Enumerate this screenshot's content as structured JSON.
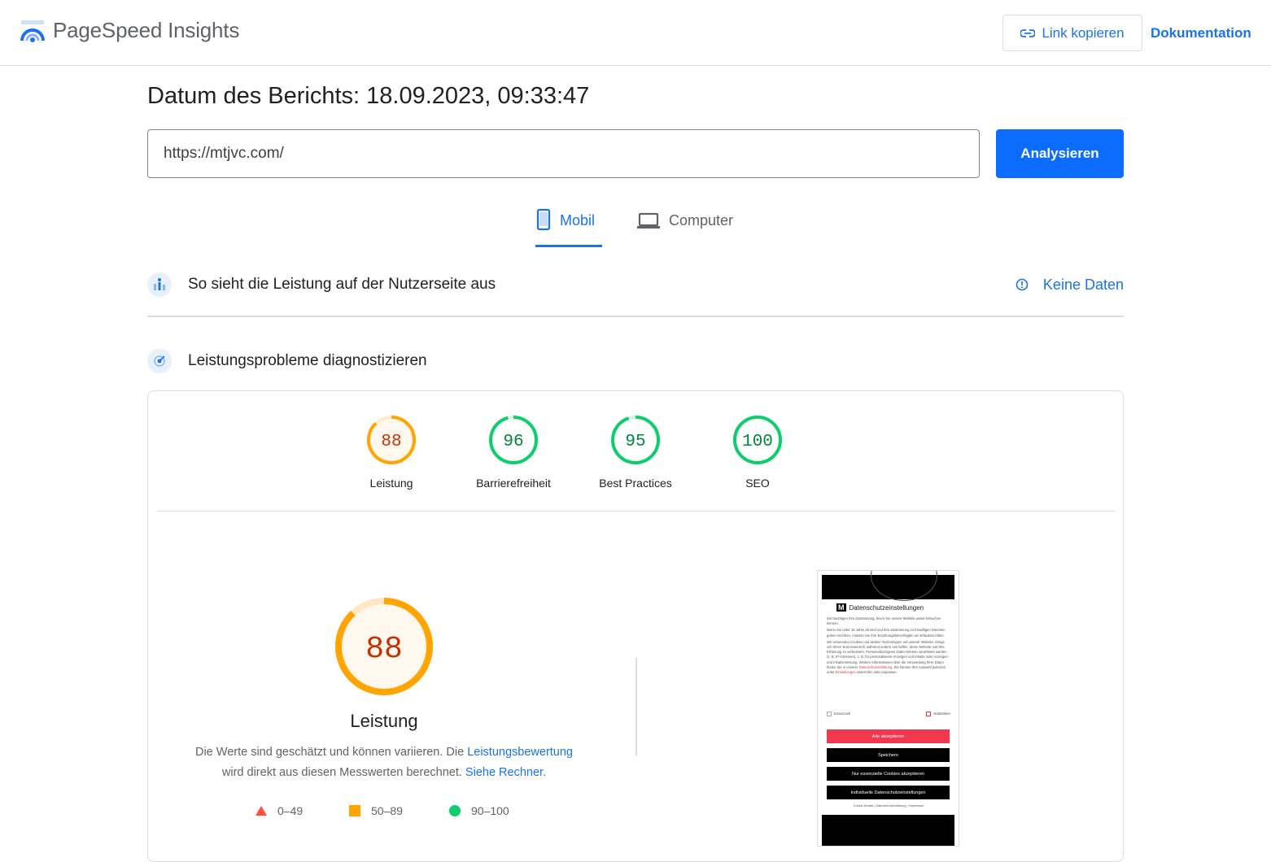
{
  "header": {
    "brand": "PageSpeed Insights",
    "copy_link_label": "Link kopieren",
    "docs_label": "Dokumentation"
  },
  "report": {
    "date_label": "Datum des Berichts: 18.09.2023, 09:33:47",
    "url_value": "https://mtjvc.com/",
    "analyze_label": "Analysieren"
  },
  "tabs": [
    {
      "label": "Mobil",
      "icon": "phone-icon",
      "active": true
    },
    {
      "label": "Computer",
      "icon": "laptop-icon",
      "active": false
    }
  ],
  "field_section": {
    "title": "So sieht die Leistung auf der Nutzerseite aus",
    "status": "Keine Daten"
  },
  "diagnose_section": {
    "title": "Leistungsprobleme diagnostizieren"
  },
  "scores": [
    {
      "label": "Leistung",
      "value": "88",
      "score": 0.88,
      "color": "#ffa400",
      "text_color": "#c33300",
      "fill": "#fff8ef"
    },
    {
      "label": "Barrierefreiheit",
      "value": "96",
      "score": 0.96,
      "color": "#0cce6b",
      "text_color": "#018642",
      "fill": "#ffffff"
    },
    {
      "label": "Best Practices",
      "value": "95",
      "score": 0.95,
      "color": "#0cce6b",
      "text_color": "#018642",
      "fill": "#ffffff"
    },
    {
      "label": "SEO",
      "value": "100",
      "score": 1.0,
      "color": "#0cce6b",
      "text_color": "#018642",
      "fill": "#ffffff"
    }
  ],
  "performance": {
    "value": "88",
    "score": 0.88,
    "title": "Leistung",
    "desc_part1": "Die Werte sind geschätzt und können variieren. Die ",
    "desc_link1": "Leistungsbewertung",
    "desc_part2": "wird direkt aus diesen Messwerten berechnet. ",
    "desc_link2": "Siehe Rechner."
  },
  "legend": [
    {
      "shape": "triangle",
      "range": "0–49",
      "color": "#ff4e42"
    },
    {
      "shape": "square",
      "range": "50–89",
      "color": "#ffa400"
    },
    {
      "shape": "circle",
      "range": "90–100",
      "color": "#0cce6b"
    }
  ],
  "thumbnail": {
    "title": "Datenschutzeinstellungen",
    "logo": "M",
    "para1": "Wir benötigen Ihre Zustimmung, bevor Sie unsere Website weiter besuchen können.",
    "para2": "Wenn Sie unter 16 Jahre alt sind und Ihre Zustimmung zu freiwilligen Diensten geben möchten, müssen Sie Ihre Erziehungsberechtigten um Erlaubnis bitten.",
    "para3": "Wir verwenden Cookies und andere Technologien auf unserer Website. Einige von ihnen sind essenziell, während andere uns helfen, diese Website und Ihre Erfahrung zu verbessern. Personenbezogene Daten können verarbeitet werden (z. B. IP-Adressen), z. B. für personalisierte Anzeigen und Inhalte oder Anzeigen- und Inhaltsmessung. Weitere Informationen über die Verwendung Ihrer Daten finden Sie in unserer",
    "para3_link": "Datenschutzerklärung",
    "para3_end": ". Sie können Ihre Auswahl jederzeit unter",
    "para3_link2": "Einstellungen",
    "para3_end2": "widerrufen oder anpassen.",
    "check1": "Essenziell",
    "check2": "Statistiken",
    "btn_accept": "Alle akzeptieren",
    "btn_save": "Speichern",
    "btn_essential": "Nur essenzielle Cookies akzeptieren",
    "btn_individual": "Individuelle Datenschutzeinstellungen",
    "footer": "Cookie-Details | Datenschutzerklärung | Impressum"
  },
  "colors": {
    "accent": "#1a73e8",
    "analyze_button": "#0b6cff",
    "orange": "#ffa400",
    "green": "#0cce6b"
  }
}
